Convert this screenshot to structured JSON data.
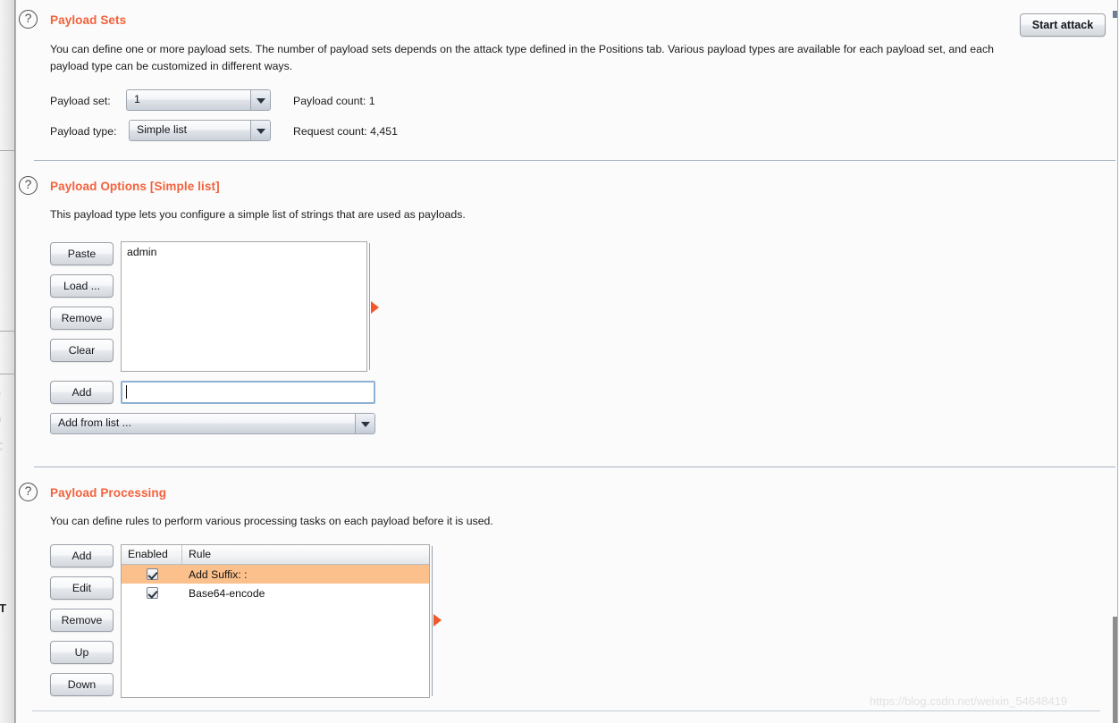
{
  "window": {
    "toolbar": {
      "start_attack_label": "Start attack"
    },
    "watermark": "https://blog.csdn.net/weixin_54648419"
  },
  "sections": [
    {
      "id": "payload-sets",
      "help_icon": "?",
      "title": "Payload Sets",
      "description": "You can define one or more payload sets. The number of payload sets depends on the attack type defined in the Positions tab. Various payload types are available for each payload set, and each payload type can be customized in different ways.",
      "fields": {
        "payload_set_label": "Payload set:",
        "payload_set_value": "1",
        "payload_type_label": "Payload type:",
        "payload_type_value": "Simple list",
        "payload_count_text": "Payload count:  1",
        "request_count_text": "Request count: 4,451"
      }
    },
    {
      "id": "payload-options",
      "help_icon": "?",
      "title": "Payload Options [Simple list]",
      "description": "This payload type lets you configure a simple list of strings that are used as payloads.",
      "buttons": [
        {
          "name": "paste-button",
          "label": "Paste"
        },
        {
          "name": "load-button",
          "label": "Load ..."
        },
        {
          "name": "remove-button",
          "label": "Remove"
        },
        {
          "name": "clear-button",
          "label": "Clear"
        }
      ],
      "list_items": [
        "admin"
      ],
      "add_button_label": "Add",
      "add_input_value": "",
      "add_input_placeholder": "",
      "add_from_list_value": "Add from list ..."
    },
    {
      "id": "payload-processing",
      "help_icon": "?",
      "title": "Payload Processing",
      "description": "You can define rules to perform various processing tasks on each payload before it is used.",
      "buttons": [
        {
          "name": "add-rule-button",
          "label": "Add"
        },
        {
          "name": "edit-rule-button",
          "label": "Edit"
        },
        {
          "name": "remove-rule-button",
          "label": "Remove"
        },
        {
          "name": "move-up-button",
          "label": "Up"
        },
        {
          "name": "move-down-button",
          "label": "Down"
        }
      ],
      "table": {
        "columns": [
          "Enabled",
          "Rule"
        ],
        "rows": [
          {
            "enabled": true,
            "rule": "Add Suffix: :",
            "selected": true
          },
          {
            "enabled": true,
            "rule": "Base64-encode",
            "selected": false
          }
        ]
      }
    }
  ],
  "colors": {
    "accent_orange": "#f4613b",
    "marker_orange": "#f4582a",
    "selected_row": "#fbc08c",
    "divider": "#a9b2c3",
    "panel_bg": "#fbfbfb"
  }
}
